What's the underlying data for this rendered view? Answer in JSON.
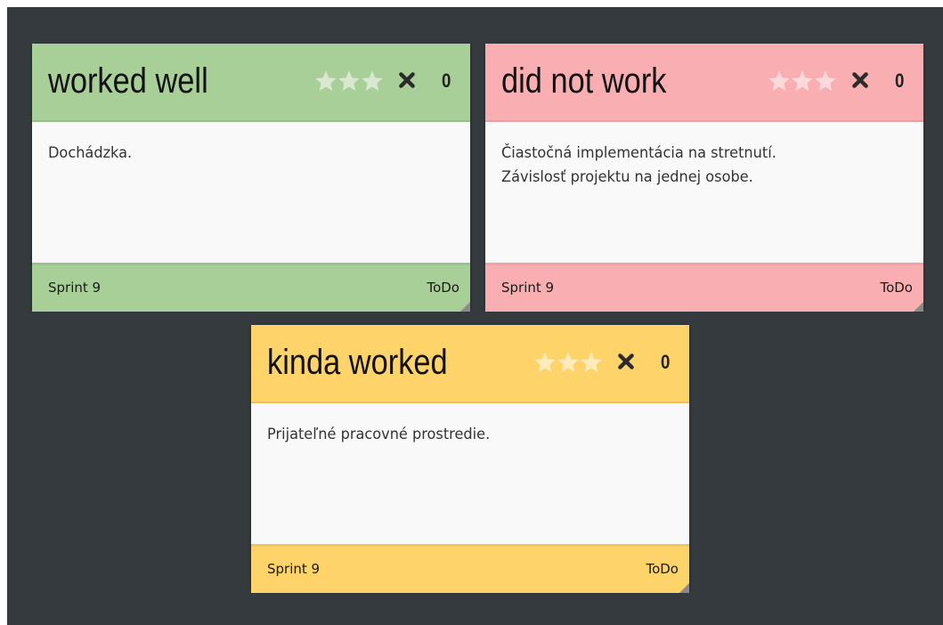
{
  "board": {
    "background": "#343a3d"
  },
  "cards": [
    {
      "title": "worked well",
      "body": "Dochádzka.",
      "sprint": "Sprint 9",
      "status": "ToDo",
      "votes": "0",
      "rating_stars": 3,
      "color": "#a8cf97",
      "icons": {
        "stars": "star-icon",
        "delete": "close-icon"
      }
    },
    {
      "title": "did not work",
      "body": "Čiastočná implementácia na stretnutí.\nZávislosť projektu na jednej osobe.",
      "sprint": "Sprint 9",
      "status": "ToDo",
      "votes": "0",
      "rating_stars": 3,
      "color": "#f9aeb2",
      "icons": {
        "stars": "star-icon",
        "delete": "close-icon"
      }
    },
    {
      "title": "kinda worked",
      "body": "Prijateľné pracovné prostredie.",
      "sprint": "Sprint 9",
      "status": "ToDo",
      "votes": "0",
      "rating_stars": 3,
      "color": "#fdd36a",
      "icons": {
        "stars": "star-icon",
        "delete": "close-icon"
      }
    }
  ]
}
